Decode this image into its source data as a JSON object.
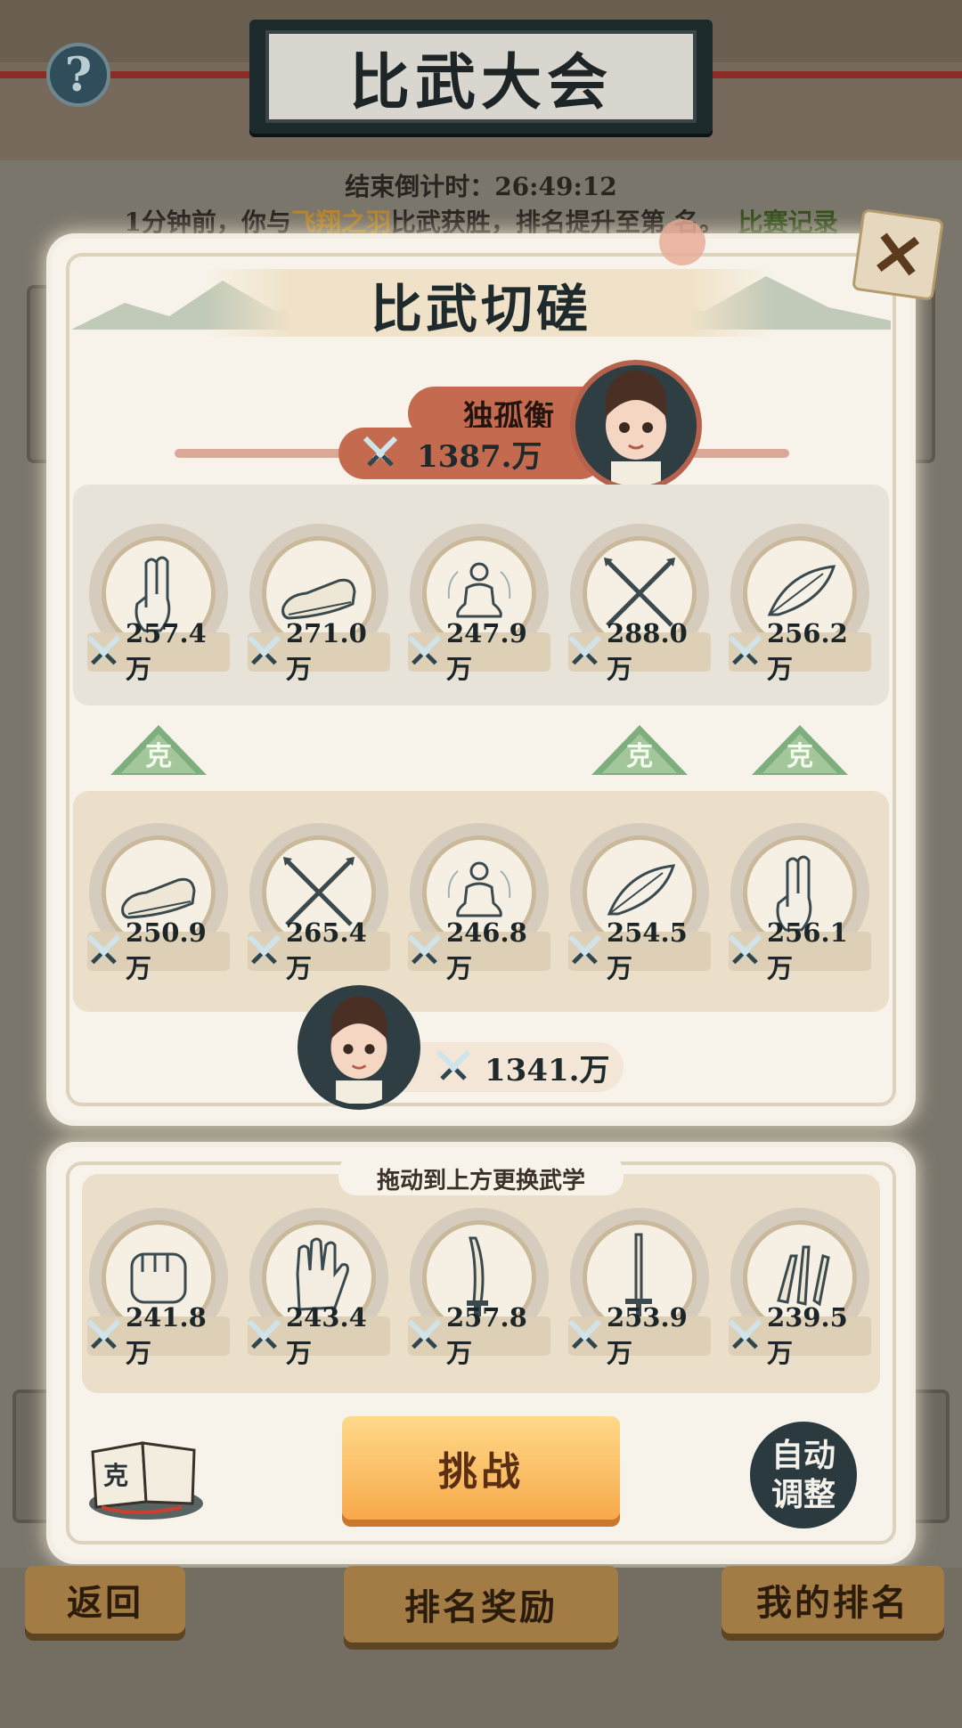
{
  "header": {
    "title": "比武大会",
    "help_icon": "?"
  },
  "countdown": "结束倒计时：26:49:12",
  "notice": {
    "prefix": "1分钟前，你与",
    "opponent": "飞翔之羽",
    "suffix": "比武获胜，排名提升至第 名。",
    "link": "比赛记录"
  },
  "modal": {
    "title": "比武切磋",
    "close_icon": "close-x-icon",
    "opponent": {
      "name": "独孤衡",
      "power": "1387.万"
    },
    "opponent_skills": [
      {
        "icon": "finger-point-icon",
        "power": "257.4万"
      },
      {
        "icon": "shoe-icon",
        "power": "271.0万"
      },
      {
        "icon": "meditation-icon",
        "power": "247.9万"
      },
      {
        "icon": "crossed-spears-icon",
        "power": "288.0万"
      },
      {
        "icon": "feather-icon",
        "power": "256.2万"
      }
    ],
    "counter_label": "克",
    "counter_marks": [
      true,
      false,
      false,
      true,
      true
    ],
    "player_skills": [
      {
        "icon": "shoe-icon",
        "power": "250.9万"
      },
      {
        "icon": "crossed-spears-icon",
        "power": "265.4万"
      },
      {
        "icon": "meditation-icon",
        "power": "246.8万"
      },
      {
        "icon": "feather-icon",
        "power": "254.5万"
      },
      {
        "icon": "finger-point-icon",
        "power": "256.1万"
      }
    ],
    "player": {
      "power": "1341.万"
    }
  },
  "inventory": {
    "hint": "拖动到上方更换武学",
    "skills": [
      {
        "icon": "fist-icon",
        "power": "241.8万"
      },
      {
        "icon": "palm-icon",
        "power": "243.4万"
      },
      {
        "icon": "saber-icon",
        "power": "257.8万"
      },
      {
        "icon": "sword-icon",
        "power": "253.9万"
      },
      {
        "icon": "throwing-knives-icon",
        "power": "239.5万"
      }
    ],
    "challenge_label": "挑战",
    "book_label": "克",
    "auto_label_1": "自动",
    "auto_label_2": "调整"
  },
  "bottom_nav": {
    "back": "返回",
    "rewards": "排名奖励",
    "my_rank": "我的排名"
  },
  "colors": {
    "accent_orange": "#f7a94a",
    "counter_green": "#7fae7e",
    "name_plate": "#c46b4f"
  }
}
